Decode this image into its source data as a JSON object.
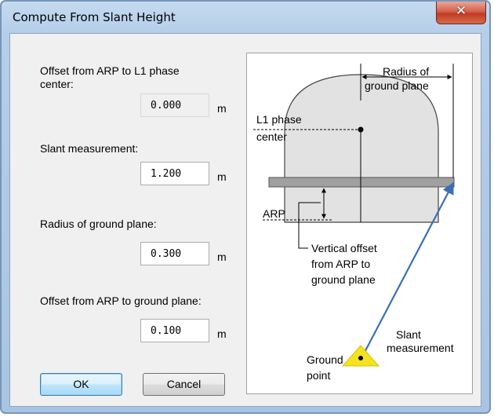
{
  "window": {
    "title": "Compute From Slant Height",
    "close_glyph": "✕"
  },
  "form": {
    "offset_l1": {
      "label": "Offset from ARP to L1 phase center:",
      "value": "0.000",
      "unit": "m"
    },
    "slant": {
      "label": "Slant measurement:",
      "value": "1.200",
      "unit": "m"
    },
    "radius": {
      "label": "Radius of ground plane:",
      "value": "0.300",
      "unit": "m"
    },
    "offset_gp": {
      "label": "Offset from ARP to ground plane:",
      "value": "0.100",
      "unit": "m"
    }
  },
  "buttons": {
    "ok": "OK",
    "cancel": "Cancel"
  },
  "diagram": {
    "radius_line1": "Radius of",
    "radius_line2": "ground plane",
    "l1_line1": "L1 phase",
    "l1_line2": "center",
    "arp": "ARP",
    "vert_line1": "Vertical offset",
    "vert_line2": "from ARP to",
    "vert_line3": "ground plane",
    "slant_line1": "Slant",
    "slant_line2": "measurement",
    "ground_line1": "Ground",
    "ground_line2": "point",
    "colors": {
      "slant_arrow": "#3a6fb5",
      "ground_marker": "#f5e31d",
      "ground_plane": "#a0a0a0",
      "antenna_dome": "#e2e2e2"
    }
  }
}
